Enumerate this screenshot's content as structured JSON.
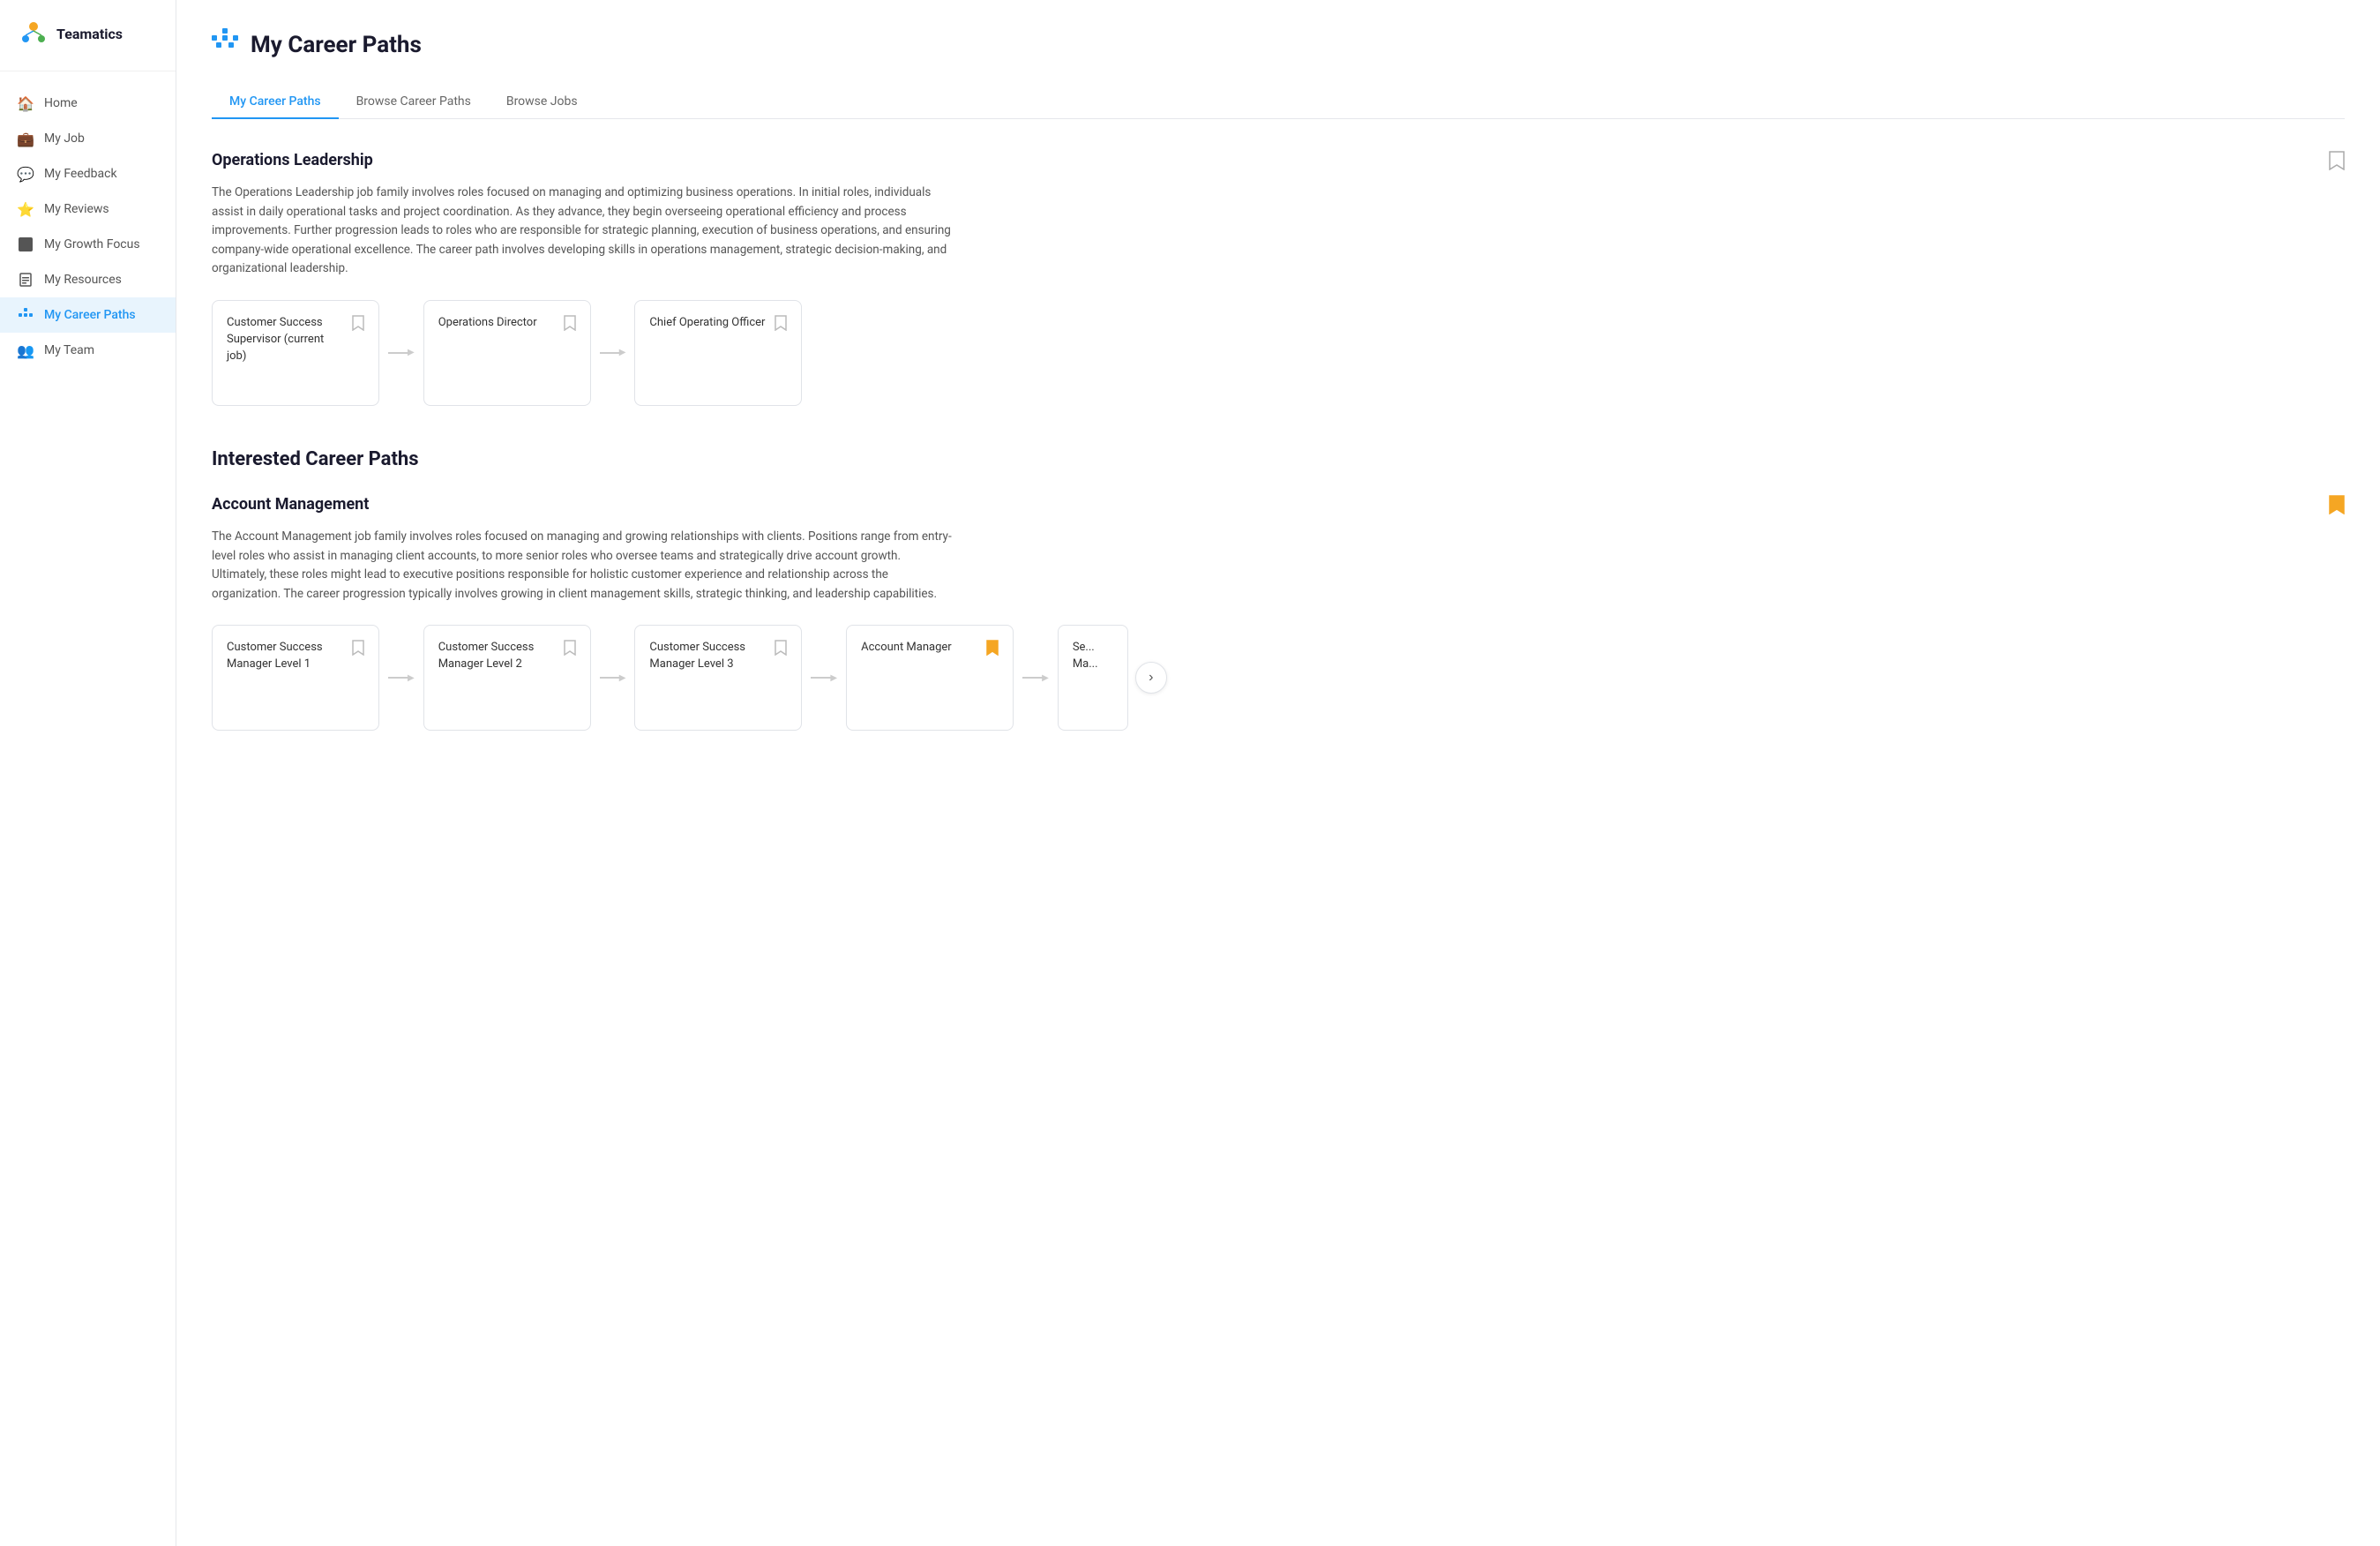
{
  "app": {
    "name": "Teamatics"
  },
  "sidebar": {
    "items": [
      {
        "id": "home",
        "label": "Home",
        "icon": "🏠",
        "active": false
      },
      {
        "id": "my-job",
        "label": "My Job",
        "icon": "💼",
        "active": false
      },
      {
        "id": "my-feedback",
        "label": "My Feedback",
        "icon": "💬",
        "active": false
      },
      {
        "id": "my-reviews",
        "label": "My Reviews",
        "icon": "⭐",
        "active": false
      },
      {
        "id": "my-growth-focus",
        "label": "My Growth Focus",
        "icon": "⬛",
        "active": false
      },
      {
        "id": "my-resources",
        "label": "My Resources",
        "icon": "📄",
        "active": false
      },
      {
        "id": "my-career-paths",
        "label": "My Career Paths",
        "icon": "🎯",
        "active": true
      },
      {
        "id": "my-team",
        "label": "My Team",
        "icon": "👥",
        "active": false
      }
    ]
  },
  "page": {
    "title": "My Career Paths",
    "icon": "📌"
  },
  "tabs": [
    {
      "id": "my-career-paths",
      "label": "My Career Paths",
      "active": true
    },
    {
      "id": "browse-career-paths",
      "label": "Browse Career Paths",
      "active": false
    },
    {
      "id": "browse-jobs",
      "label": "Browse Jobs",
      "active": false
    }
  ],
  "sections": {
    "operations_leadership": {
      "title": "Operations Leadership",
      "bookmarked": false,
      "description": "The Operations Leadership job family involves roles focused on managing and optimizing business operations. In initial roles, individuals assist in daily operational tasks and project coordination. As they advance, they begin overseeing operational efficiency and process improvements. Further progression leads to roles who are responsible for strategic planning, execution of business operations, and ensuring company-wide operational excellence. The career path involves developing skills in operations management, strategic decision-making, and organizational leadership.",
      "cards": [
        {
          "id": "css-supervisor",
          "title": "Customer Success Supervisor (current job)",
          "bookmarked": false
        },
        {
          "id": "operations-director",
          "title": "Operations Director",
          "bookmarked": false
        },
        {
          "id": "coo",
          "title": "Chief Operating Officer",
          "bookmarked": false
        }
      ]
    },
    "interested_section_title": "Interested Career Paths",
    "account_management": {
      "title": "Account Management",
      "bookmarked": true,
      "description": "The Account Management job family involves roles focused on managing and growing relationships with clients. Positions range from entry-level roles who assist in managing client accounts, to more senior roles who oversee teams and strategically drive account growth. Ultimately, these roles might lead to executive positions responsible for holistic customer experience and relationship across the organization. The career progression typically involves growing in client management skills, strategic thinking, and leadership capabilities.",
      "cards": [
        {
          "id": "csm-level-1",
          "title": "Customer Success Manager Level 1",
          "bookmarked": false
        },
        {
          "id": "csm-level-2",
          "title": "Customer Success Manager Level 2",
          "bookmarked": false
        },
        {
          "id": "csm-level-3",
          "title": "Customer Success Manager Level 3",
          "bookmarked": false
        },
        {
          "id": "account-manager",
          "title": "Account Manager",
          "bookmarked": true
        },
        {
          "id": "senior-manager",
          "title": "Se... Ma...",
          "bookmarked": false
        }
      ]
    }
  },
  "ui": {
    "accent_blue": "#2196f3",
    "accent_orange": "#f5a623",
    "bookmark_empty": "🔖",
    "scroll_next": "›"
  }
}
